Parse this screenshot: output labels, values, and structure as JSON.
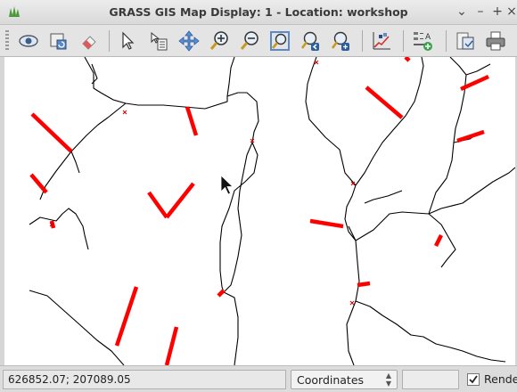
{
  "window": {
    "title": "GRASS GIS Map Display: 1  - Location: workshop"
  },
  "toolbar": {
    "tools": [
      {
        "name": "display-map-icon"
      },
      {
        "name": "render-map-icon"
      },
      {
        "name": "erase-display-icon"
      },
      {
        "name": "pointer-icon"
      },
      {
        "name": "query-icon"
      },
      {
        "name": "pan-icon"
      },
      {
        "name": "zoom-in-icon"
      },
      {
        "name": "zoom-out-icon"
      },
      {
        "name": "zoom-extent-icon"
      },
      {
        "name": "zoom-back-icon"
      },
      {
        "name": "zoom-options-icon"
      },
      {
        "name": "analyze-icon"
      },
      {
        "name": "decorations-icon"
      },
      {
        "name": "save-display-icon"
      },
      {
        "name": "print-icon"
      }
    ]
  },
  "status": {
    "coordinates": "626852.07; 207089.05",
    "mode_selected": "Coordinates",
    "render_label": "Render",
    "render_checked": true
  },
  "colors": {
    "stream_lines": "#000000",
    "highlighted_segments": "#ff0000",
    "map_background": "#ffffff"
  }
}
